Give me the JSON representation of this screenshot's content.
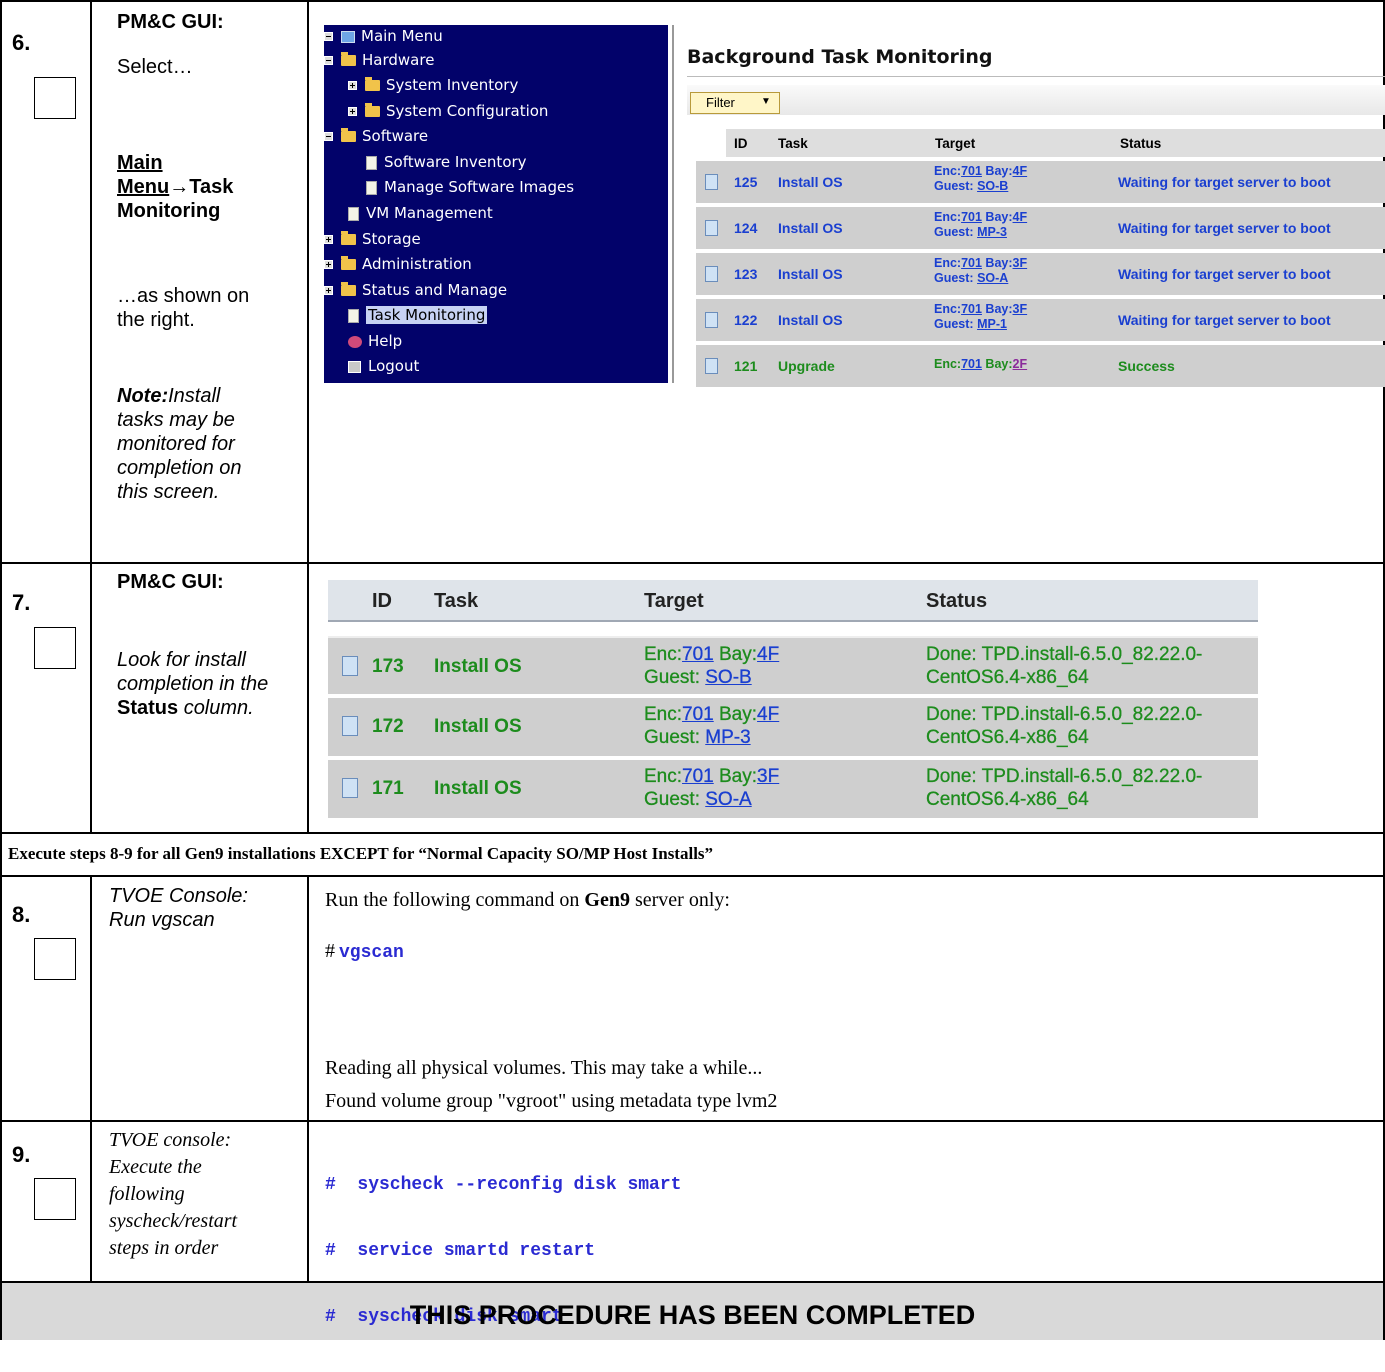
{
  "steps": [
    {
      "number": "6.",
      "heading": "PM&C GUI:",
      "select": "Select…",
      "menu_path_main": "Main",
      "menu_path_rest": "Menu",
      "menu_path_arrow": "→",
      "menu_path_task": "Task",
      "menu_path_monitoring": "Monitoring",
      "as_shown": "…as shown on",
      "the_right": "the right.",
      "note_label": "Note:",
      "note_lines": [
        "Install",
        "tasks may be",
        "monitored for",
        "completion on",
        "this screen."
      ]
    },
    {
      "number": "7.",
      "heading": "PM&C GUI:",
      "look_lines": [
        "Look for install",
        "completion in the"
      ],
      "status_word": "Status",
      "column_word": "column."
    },
    {
      "number": "8.",
      "heading_lines": [
        "TVOE Console:",
        "Run vgscan"
      ],
      "instruction_pre": "Run the following command on ",
      "instruction_bold": "Gen9",
      "instruction_post": " server only:",
      "prompt": "#",
      "command": "vgscan",
      "output_lines": [
        "Reading all physical volumes.  This may take a while...",
        "Found volume group \"vgroot\" using metadata type lvm2"
      ]
    },
    {
      "number": "9.",
      "heading_lines": [
        "TVOE console:",
        "Execute the",
        "following",
        "syscheck/restart",
        "steps in order"
      ],
      "commands": [
        "#  syscheck --reconfig disk smart",
        "#  service smartd restart",
        "#  syscheck disk smart"
      ]
    }
  ],
  "banner_gen9": "Execute steps 8-9 for all Gen9 installations EXCEPT for “Normal Capacity SO/MP Host Installs”",
  "completed_banner": "THIS PROCEDURE HAS BEEN COMPLETED",
  "menu": {
    "items": [
      {
        "label": "Main Menu",
        "icon": "monitor-icon"
      },
      {
        "label": "Hardware",
        "icon": "folder-open-icon"
      },
      {
        "label": "System Inventory",
        "icon": "folder-icon"
      },
      {
        "label": "System Configuration",
        "icon": "folder-icon"
      },
      {
        "label": "Software",
        "icon": "folder-open-icon"
      },
      {
        "label": "Software Inventory",
        "icon": "document-icon"
      },
      {
        "label": "Manage Software Images",
        "icon": "document-icon"
      },
      {
        "label": "VM Management",
        "icon": "document-icon"
      },
      {
        "label": "Storage",
        "icon": "folder-icon"
      },
      {
        "label": "Administration",
        "icon": "folder-icon"
      },
      {
        "label": "Status and Manage",
        "icon": "folder-icon"
      },
      {
        "label": "Task Monitoring",
        "icon": "document-icon"
      },
      {
        "label": "Help",
        "icon": "help-icon"
      },
      {
        "label": "Logout",
        "icon": "logout-icon"
      }
    ]
  },
  "btm": {
    "title": "Background Task Monitoring",
    "filter_label": "Filter",
    "columns": [
      "ID",
      "Task",
      "Target",
      "Status"
    ],
    "rows": [
      {
        "id": "125",
        "task": "Install OS",
        "enc_pre": "Enc:",
        "enc": "701",
        "bay_pre": " Bay:",
        "bay": "4F",
        "guest_pre": "Guest: ",
        "guest": "SO-B",
        "status": "Waiting for target server to boot"
      },
      {
        "id": "124",
        "task": "Install OS",
        "enc_pre": "Enc:",
        "enc": "701",
        "bay_pre": " Bay:",
        "bay": "4F",
        "guest_pre": "Guest: ",
        "guest": "MP-3",
        "status": "Waiting for target server to boot"
      },
      {
        "id": "123",
        "task": "Install OS",
        "enc_pre": "Enc:",
        "enc": "701",
        "bay_pre": " Bay:",
        "bay": "3F",
        "guest_pre": "Guest: ",
        "guest": "SO-A",
        "status": "Waiting for target server to boot"
      },
      {
        "id": "122",
        "task": "Install OS",
        "enc_pre": "Enc:",
        "enc": "701",
        "bay_pre": " Bay:",
        "bay": "3F",
        "guest_pre": "Guest: ",
        "guest": "MP-1",
        "status": "Waiting for target server to boot"
      },
      {
        "id": "121",
        "task": "Upgrade",
        "enc_pre": "Enc:",
        "enc": "701",
        "bay_pre": " Bay:",
        "bay": "2F",
        "guest_pre": "",
        "guest": "",
        "status": "Success"
      }
    ]
  },
  "done_table": {
    "columns": [
      "ID",
      "Task",
      "Target",
      "Status"
    ],
    "rows": [
      {
        "id": "173",
        "task": "Install OS",
        "enc_pre": "Enc:",
        "enc": "701",
        "bay_pre": " Bay:",
        "bay": "4F",
        "guest_pre": "Guest: ",
        "guest": "SO-B",
        "status1": "Done: TPD.install-6.5.0_82.22.0-",
        "status2": "CentOS6.4-x86_64"
      },
      {
        "id": "172",
        "task": "Install OS",
        "enc_pre": "Enc:",
        "enc": "701",
        "bay_pre": " Bay:",
        "bay": "4F",
        "guest_pre": "Guest: ",
        "guest": "MP-3",
        "status1": "Done: TPD.install-6.5.0_82.22.0-",
        "status2": "CentOS6.4-x86_64"
      },
      {
        "id": "171",
        "task": "Install OS",
        "enc_pre": "Enc:",
        "enc": "701",
        "bay_pre": " Bay:",
        "bay": "3F",
        "guest_pre": "Guest: ",
        "guest": "SO-A",
        "status1": "Done: TPD.install-6.5.0_82.22.0-",
        "status2": "CentOS6.4-x86_64"
      }
    ]
  },
  "colors": {
    "menu_bg": "#02026a",
    "link_blue": "#1a3fd0",
    "success_green": "#1d8c1d",
    "row_gray": "#cfcfcf",
    "banner_gray": "#d9d9d9"
  }
}
